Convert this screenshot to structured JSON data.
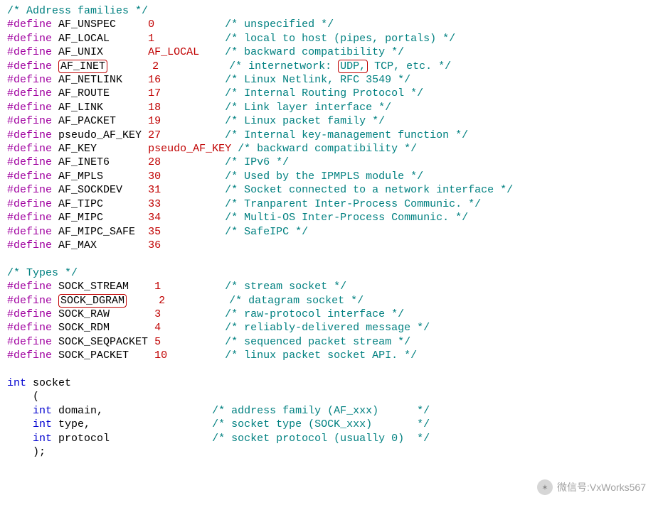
{
  "af_header": "/* Address families */",
  "af": [
    {
      "name": "AF_UNSPEC",
      "value": "0",
      "comment": "/* unspecified */",
      "boxName": false,
      "boxInComment": null
    },
    {
      "name": "AF_LOCAL",
      "value": "1",
      "comment": "/* local to host (pipes, portals) */",
      "boxName": false,
      "boxInComment": null
    },
    {
      "name": "AF_UNIX",
      "value": "AF_LOCAL",
      "comment": "/* backward compatibility */",
      "boxName": false,
      "boxInComment": null
    },
    {
      "name": "AF_INET",
      "value": "2",
      "commentPre": "/* internetwork: ",
      "commentBoxed": "UDP,",
      "commentPost": " TCP, etc. */",
      "boxName": true
    },
    {
      "name": "AF_NETLINK",
      "value": "16",
      "comment": "/* Linux Netlink, RFC 3549 */",
      "boxName": false,
      "boxInComment": null
    },
    {
      "name": "AF_ROUTE",
      "value": "17",
      "comment": "/* Internal Routing Protocol */",
      "boxName": false,
      "boxInComment": null
    },
    {
      "name": "AF_LINK",
      "value": "18",
      "comment": "/* Link layer interface */",
      "boxName": false,
      "boxInComment": null
    },
    {
      "name": "AF_PACKET",
      "value": "19",
      "comment": "/* Linux packet family */",
      "boxName": false,
      "boxInComment": null
    },
    {
      "name": "pseudo_AF_KEY",
      "value": "27",
      "comment": "/* Internal key-management function */",
      "boxName": false,
      "boxInComment": null
    },
    {
      "name": "AF_KEY",
      "value": "pseudo_AF_KEY",
      "comment": "/* backward compatibility */",
      "boxName": false,
      "boxInComment": null,
      "valueWide": true
    },
    {
      "name": "AF_INET6",
      "value": "28",
      "comment": "/* IPv6 */",
      "boxName": false,
      "boxInComment": null
    },
    {
      "name": "AF_MPLS",
      "value": "30",
      "comment": "/* Used by the IPMPLS module */",
      "boxName": false,
      "boxInComment": null
    },
    {
      "name": "AF_SOCKDEV",
      "value": "31",
      "comment": "/* Socket connected to a network interface */",
      "boxName": false,
      "boxInComment": null
    },
    {
      "name": "AF_TIPC",
      "value": "33",
      "comment": "/* Tranparent Inter-Process Communic. */",
      "boxName": false,
      "boxInComment": null
    },
    {
      "name": "AF_MIPC",
      "value": "34",
      "comment": "/* Multi-OS Inter-Process Communic. */",
      "boxName": false,
      "boxInComment": null
    },
    {
      "name": "AF_MIPC_SAFE",
      "value": "35",
      "comment": "/* SafeIPC */",
      "boxName": false,
      "boxInComment": null
    },
    {
      "name": "AF_MAX",
      "value": "36",
      "comment": "",
      "boxName": false,
      "boxInComment": null
    }
  ],
  "types_header": "/* Types */",
  "types": [
    {
      "name": "SOCK_STREAM",
      "value": "1",
      "comment": "/* stream socket */",
      "boxName": false
    },
    {
      "name": "SOCK_DGRAM",
      "value": "2",
      "comment": "/* datagram socket */",
      "boxName": true
    },
    {
      "name": "SOCK_RAW",
      "value": "3",
      "comment": "/* raw-protocol interface */",
      "boxName": false
    },
    {
      "name": "SOCK_RDM",
      "value": "4",
      "comment": "/* reliably-delivered message */",
      "boxName": false
    },
    {
      "name": "SOCK_SEQPACKET",
      "value": "5",
      "comment": "/* sequenced packet stream */",
      "boxName": false
    },
    {
      "name": "SOCK_PACKET",
      "value": "10",
      "comment": "/* linux packet socket API. */",
      "boxName": false
    }
  ],
  "func": {
    "ret_kw": "int",
    "name": "socket",
    "open": "(",
    "params": [
      {
        "kw": "int",
        "id": "domain,",
        "comment": "/* address family (AF_xxx)      */"
      },
      {
        "kw": "int",
        "id": "type,",
        "comment": "/* socket type (SOCK_xxx)       */"
      },
      {
        "kw": "int",
        "id": "protocol",
        "comment": "/* socket protocol (usually 0)  */"
      }
    ],
    "close": ");"
  },
  "watermark": "微信号:VxWorks567"
}
